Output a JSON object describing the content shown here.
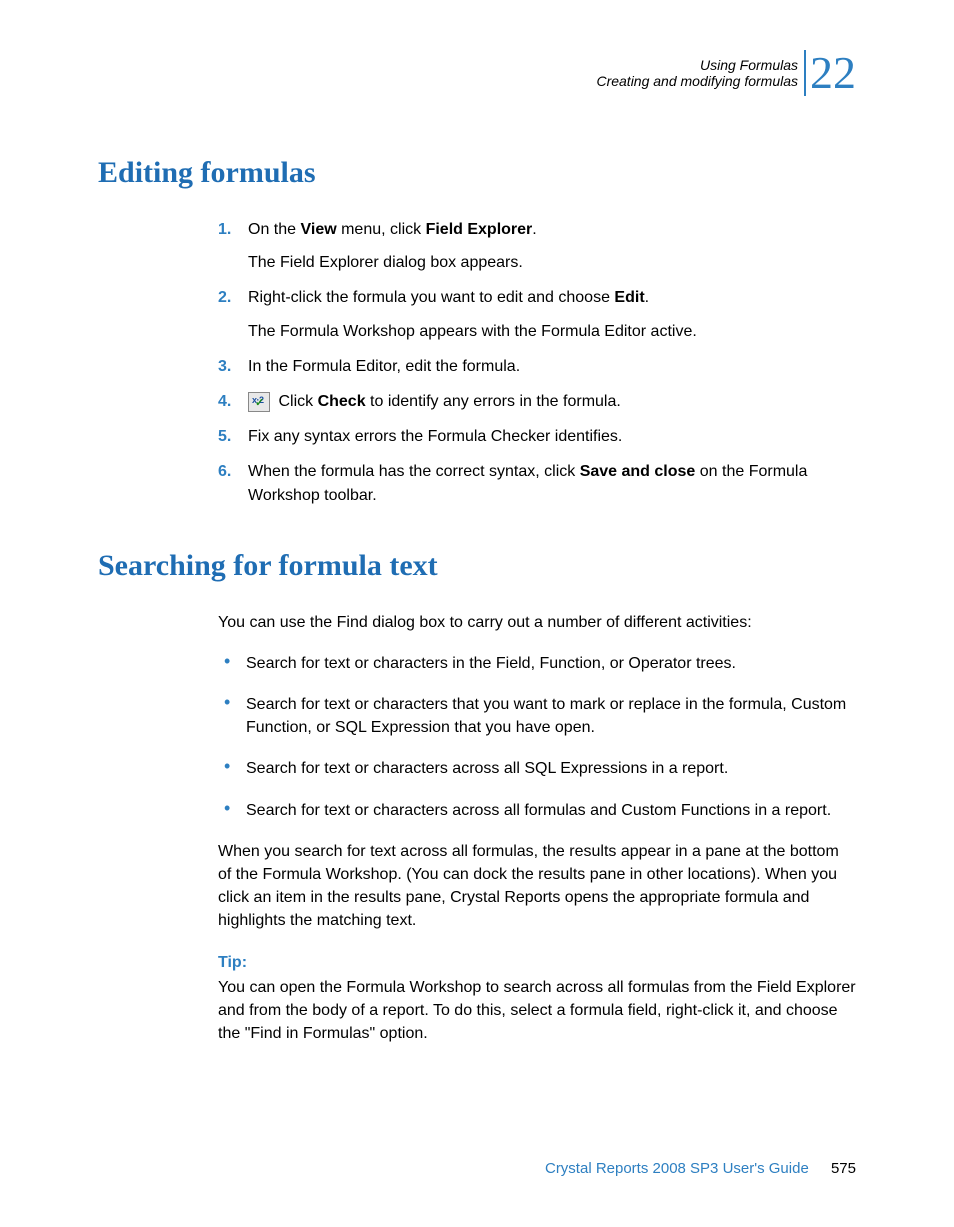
{
  "header": {
    "line1": "Using Formulas",
    "line2": "Creating and modifying formulas",
    "chapter": "22"
  },
  "section1": {
    "title": "Editing formulas",
    "steps": [
      {
        "num": "1.",
        "pre": "On the ",
        "b1": "View",
        "mid": " menu, click ",
        "b2": "Field Explorer",
        "post": ".",
        "sub": "The Field Explorer dialog box appears."
      },
      {
        "num": "2.",
        "pre": "Right-click the formula you want to edit and choose ",
        "b1": "Edit",
        "post": ".",
        "sub": "The Formula Workshop appears with the Formula Editor active."
      },
      {
        "num": "3.",
        "text": "In the Formula Editor, edit the formula."
      },
      {
        "num": "4.",
        "icon": true,
        "pre": " Click ",
        "b1": "Check",
        "post": " to identify any errors in the formula."
      },
      {
        "num": "5.",
        "text": "Fix any syntax errors the Formula Checker identifies."
      },
      {
        "num": "6.",
        "pre": "When the formula has the correct syntax, click ",
        "b1": "Save and close",
        "post": " on the Formula Workshop toolbar."
      }
    ]
  },
  "section2": {
    "title": "Searching for formula text",
    "intro": "You can use the Find dialog box to carry out a number of different activities:",
    "bullets": [
      "Search for text or characters in the Field, Function, or Operator trees.",
      "Search for text or characters that you want to mark or replace in the formula, Custom Function, or SQL Expression that you have open.",
      "Search for text or characters across all SQL Expressions in a report.",
      "Search for text or characters across all formulas and Custom Functions in a report."
    ],
    "para2": "When you search for text across all formulas, the results appear in a pane at the bottom of the Formula Workshop. (You can dock the results pane in other locations). When you click an item in the results pane, Crystal Reports opens the appropriate formula and highlights the matching text.",
    "tip_label": "Tip:",
    "tip_body": "You can open the Formula Workshop to search across all formulas from the Field Explorer and from the body of a report. To do this, select a formula field, right-click it, and choose the \"Find in Formulas\" option."
  },
  "footer": {
    "title": "Crystal Reports 2008 SP3 User's Guide",
    "page": "575"
  }
}
